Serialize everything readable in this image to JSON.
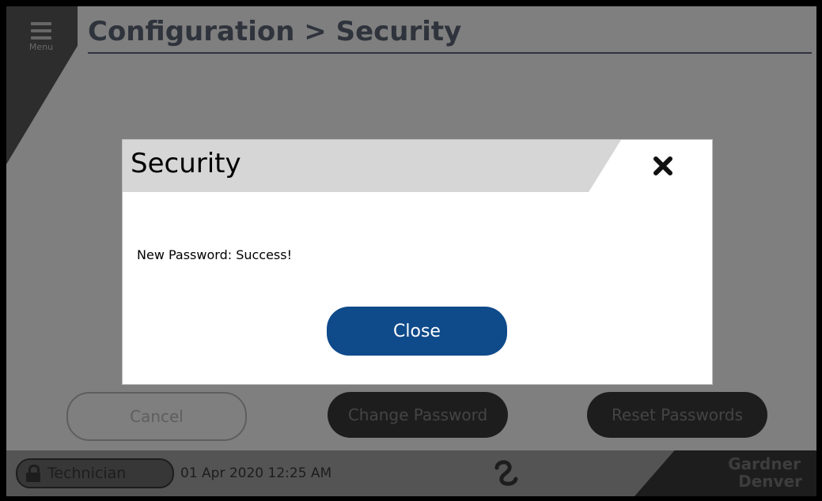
{
  "header": {
    "menu_label": "Menu",
    "page_title": "Configuration > Security"
  },
  "actions": {
    "cancel_label": "Cancel",
    "change_password_label": "Change Password",
    "reset_passwords_label": "Reset Passwords"
  },
  "status_bar": {
    "user_role": "Technician",
    "datetime": "01 Apr 2020 12:25 AM",
    "brand_line1": "Gardner",
    "brand_line2": "Denver"
  },
  "dialog": {
    "title": "Security",
    "message": "New Password: Success!",
    "close_button_label": "Close"
  },
  "colors": {
    "dialog_button": "#0f4a8a",
    "title_color": "#5e6678",
    "header_band": "#d6d6d6"
  },
  "icons": [
    "hamburger-menu-icon",
    "lock-icon",
    "swirl-logo-icon",
    "close-x-icon"
  ]
}
